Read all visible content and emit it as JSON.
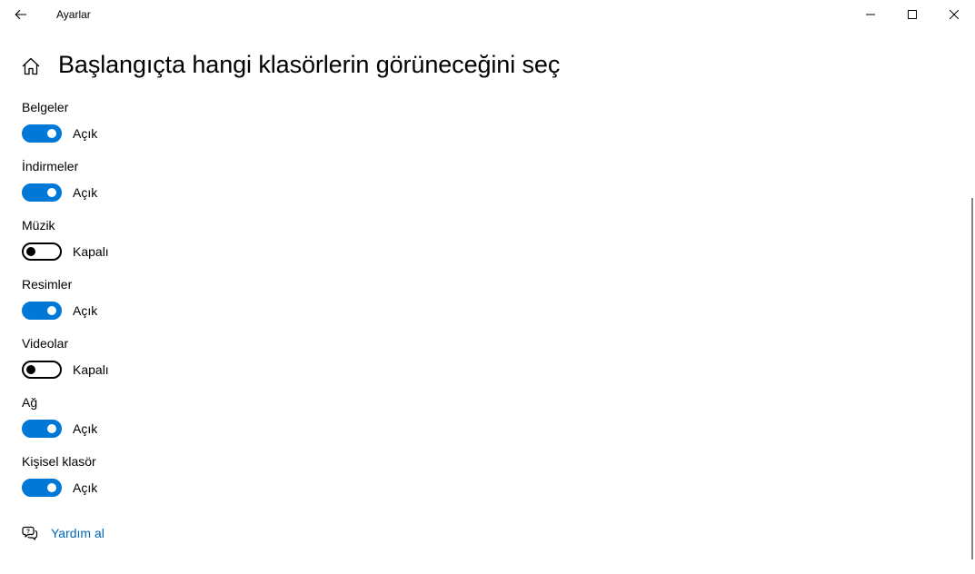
{
  "window": {
    "title": "Ayarlar"
  },
  "caption_buttons": {
    "back": "back-arrow-icon",
    "minimize": "minimize-icon",
    "maximize": "maximize-icon",
    "close": "close-icon"
  },
  "page": {
    "title": "Başlangıçta hangi klasörlerin görüneceğini seç",
    "home_icon": "home-icon"
  },
  "settings": [
    {
      "label": "Belgeler",
      "state": "Açık",
      "on": true
    },
    {
      "label": "İndirmeler",
      "state": "Açık",
      "on": true
    },
    {
      "label": "Müzik",
      "state": "Kapalı",
      "on": false
    },
    {
      "label": "Resimler",
      "state": "Açık",
      "on": true
    },
    {
      "label": "Videolar",
      "state": "Kapalı",
      "on": false
    },
    {
      "label": "Ağ",
      "state": "Açık",
      "on": true
    },
    {
      "label": "Kişisel klasör",
      "state": "Açık",
      "on": true
    }
  ],
  "help": {
    "label": "Yardım al",
    "icon": "help-chat-icon"
  },
  "colors": {
    "accent": "#0078d7",
    "link": "#0067b8",
    "text": "#000000",
    "background": "#ffffff"
  }
}
